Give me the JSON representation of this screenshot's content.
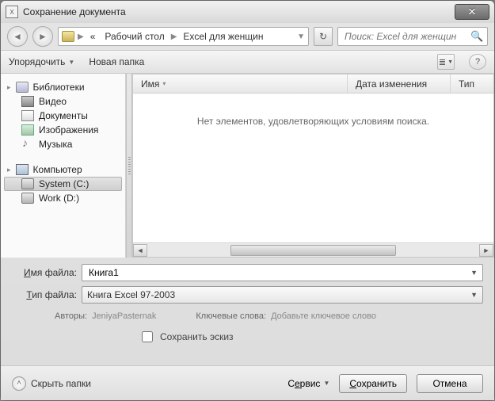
{
  "window": {
    "title": "Сохранение документа"
  },
  "nav": {
    "prefix": "«",
    "crumb1": "Рабочий стол",
    "crumb2": "Excel для женщин",
    "search_placeholder": "Поиск: Excel для женщин"
  },
  "toolbar": {
    "organize": "Упорядочить",
    "newfolder": "Новая папка"
  },
  "sidebar": {
    "libraries": "Библиотеки",
    "video": "Видео",
    "documents": "Документы",
    "images": "Изображения",
    "music": "Музыка",
    "computer": "Компьютер",
    "drive_c": "System (C:)",
    "drive_d": "Work (D:)"
  },
  "columns": {
    "name": "Имя",
    "date": "Дата изменения",
    "type": "Тип"
  },
  "empty": "Нет элементов, удовлетворяющих условиям поиска.",
  "form": {
    "filename_label": "Имя файла:",
    "filename_value": "Книга1",
    "filetype_label": "Тип файла:",
    "filetype_value": "Книга Excel 97-2003",
    "authors_label": "Авторы:",
    "authors_value": "JeniyaPasternak",
    "keywords_label": "Ключевые слова:",
    "keywords_value": "Добавьте ключевое слово",
    "thumb_label": "Сохранить эскиз"
  },
  "footer": {
    "hide": "Скрыть папки",
    "service": "Сервис",
    "save": "Сохранить",
    "cancel": "Отмена"
  }
}
